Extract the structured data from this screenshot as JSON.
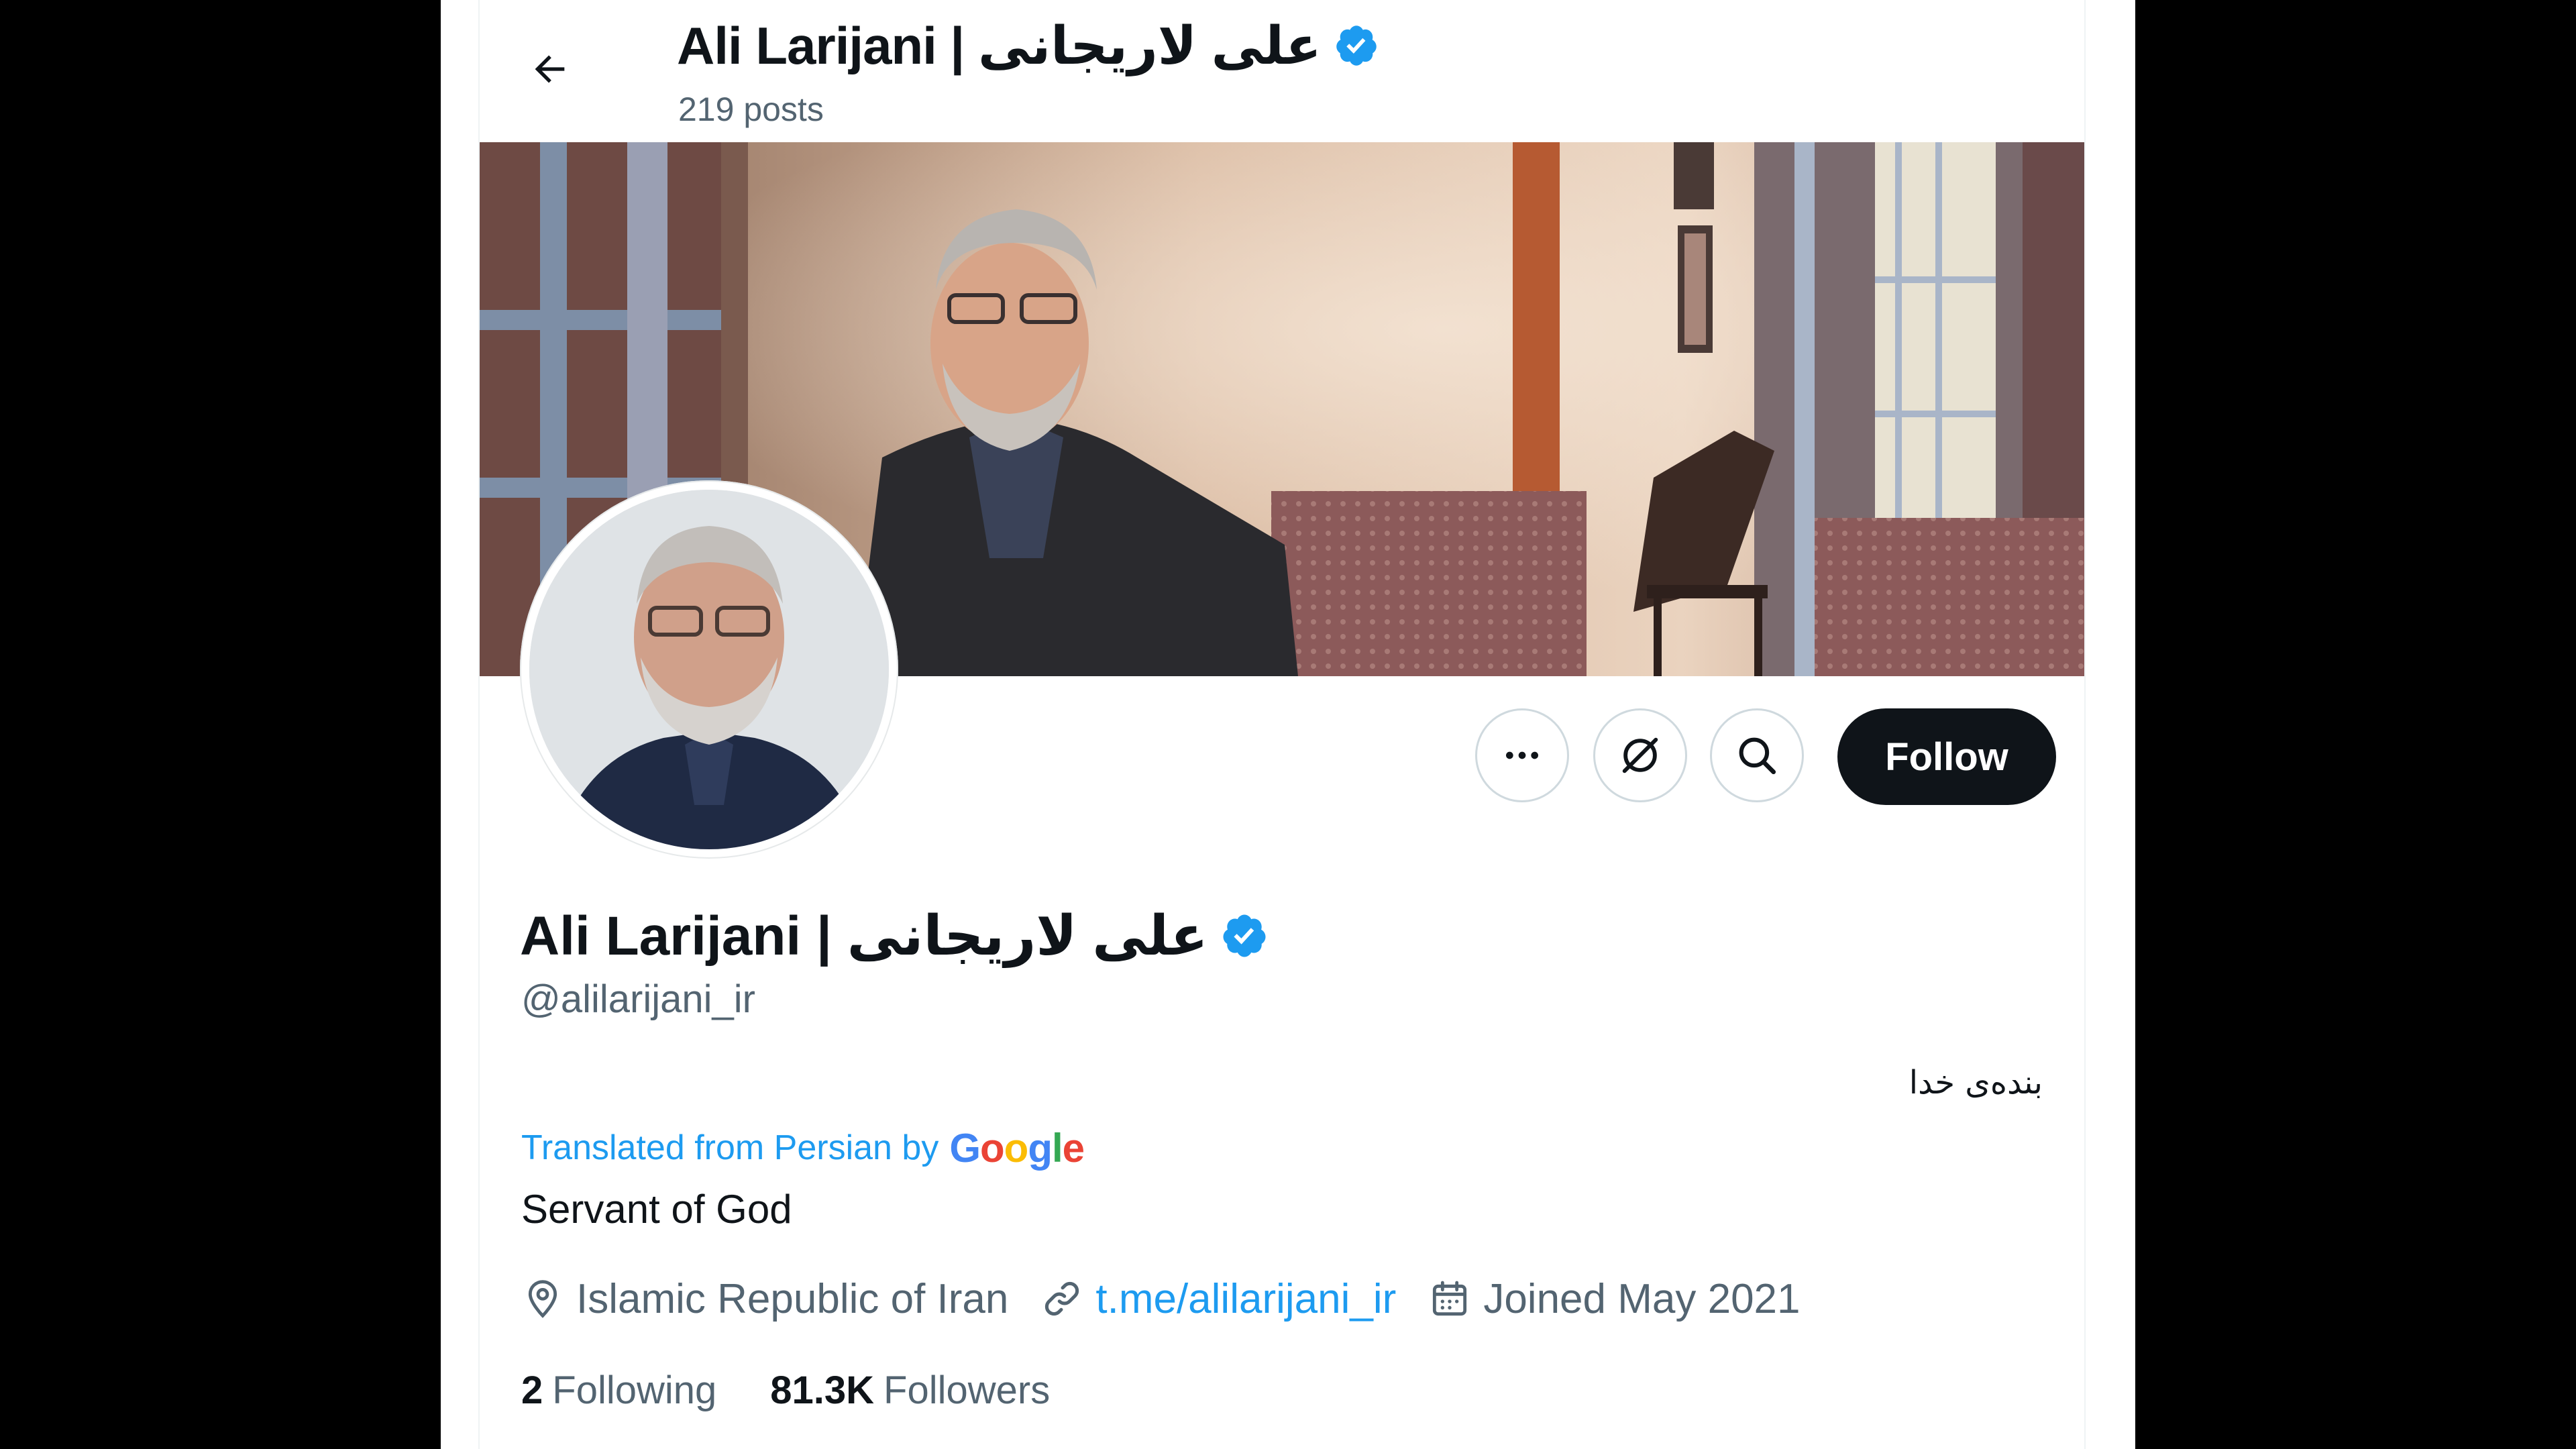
{
  "header": {
    "display_name": "Ali Larijani | علی لاریجانی",
    "posts_count": "219 posts"
  },
  "profile": {
    "display_name": "Ali Larijani | علی لاریجانی",
    "handle": "@alilarijani_ir",
    "bio_original": "بنده‌ی خدا",
    "translated_from": "Translated from Persian by",
    "translator_logo": "Google",
    "bio_translated": "Servant of God",
    "location": "Islamic Republic of Iran",
    "website": "t.me/alilarijani_ir",
    "joined": "Joined May 2021",
    "verified": true
  },
  "actions": {
    "more_icon": "ellipsis-icon",
    "grok_icon": "grok-icon",
    "search_icon": "search-icon",
    "follow_label": "Follow"
  },
  "stats": {
    "following_count": "2",
    "following_label": "Following",
    "followers_count": "81.3K",
    "followers_label": "Followers"
  },
  "colors": {
    "accent": "#1d9bf0",
    "text_primary": "#0f1419",
    "text_secondary": "#536471",
    "follow_bg": "#0f1419"
  }
}
